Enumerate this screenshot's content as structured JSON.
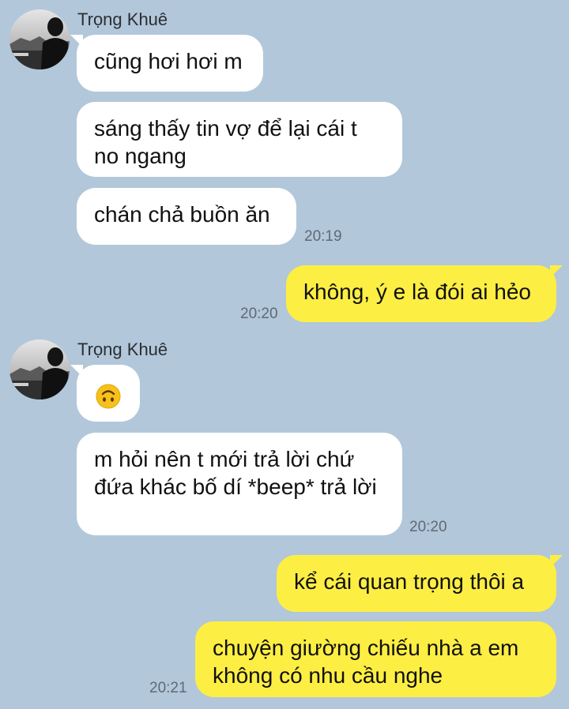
{
  "contact": {
    "name": "Trọng Khuê"
  },
  "colors": {
    "background": "#b2c7da",
    "incoming_bubble": "#ffffff",
    "outgoing_bubble": "#fdee44"
  },
  "messages": [
    {
      "from": "contact",
      "text": "cũng hơi hơi m"
    },
    {
      "from": "contact",
      "text": "sáng thấy tin vợ để lại cái t no ngang"
    },
    {
      "from": "contact",
      "text": "chán chả buồn ăn",
      "time": "20:19"
    },
    {
      "from": "me",
      "text": "không, ý e là đói ai hẻo",
      "time": "20:20"
    },
    {
      "from": "contact",
      "emoji": "upside-down-face-icon"
    },
    {
      "from": "contact",
      "text": "m hỏi nên t mới trả lời chứ đứa khác bố dí *beep* trả lời",
      "time": "20:20"
    },
    {
      "from": "me",
      "text": "kể cái quan trọng thôi a"
    },
    {
      "from": "me",
      "text": "chuyện giường chiếu nhà a em không có nhu cầu nghe",
      "time": "20:21"
    }
  ]
}
